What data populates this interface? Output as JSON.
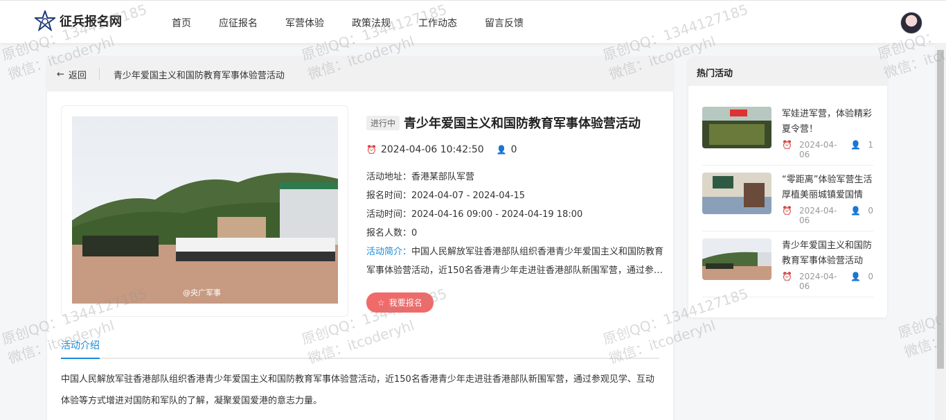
{
  "brand": {
    "name": "征兵报名网"
  },
  "nav": {
    "items": [
      "首页",
      "应征报名",
      "军营体验",
      "政策法规",
      "工作动态",
      "留言反馈"
    ]
  },
  "breadcrumb": {
    "back": "返回",
    "current": "青少年爱国主义和国防教育军事体验营活动"
  },
  "activity": {
    "status": "进行中",
    "title": "青少年爱国主义和国防教育军事体验营活动",
    "date": "2024-04-06 10:42:50",
    "views": "0",
    "address_label": "活动地址：",
    "address": "香港某部队军营",
    "signup_label": "报名时间：",
    "signup": "2024-04-07 - 2024-04-15",
    "time_label": "活动时间：",
    "time": "2024-04-16 09:00 - 2024-04-19 18:00",
    "count_label": "报名人数：",
    "count": "0",
    "intro_label": "活动简介：",
    "intro": "中国人民解放军驻香港部队组织香港青少年爱国主义和国防教育军事体验营活动，近150名香港青少年走进驻香港部队新围军营，通过参观见学、互动体验等方式增进对国防和军队的了解，凝聚爱国爱港的意志力量。",
    "apply_button": "我要报名",
    "photo_caption": "@央广军事"
  },
  "tabs": {
    "intro_tab": "活动介绍"
  },
  "description": "中国人民解放军驻香港部队组织香港青少年爱国主义和国防教育军事体验营活动，近150名香港青少年走进驻香港部队新围军营，通过参观见学、互动体验等方式增进对国防和军队的了解，凝聚爱国爱港的意志力量。",
  "sidebar": {
    "title": "热门活动",
    "items": [
      {
        "title": "军娃进军营，体验精彩夏令营！",
        "date": "2024-04-06",
        "count": "1"
      },
      {
        "title": "“零距离”体验军营生活 厚植美丽城镇爱国情",
        "date": "2024-04-06",
        "count": "0"
      },
      {
        "title": "青少年爱国主义和国防教育军事体验营活动",
        "date": "2024-04-06",
        "count": "0"
      }
    ]
  },
  "watermark": {
    "line1": "原创QQ：1344127185",
    "line2": "微信：itcoderyhl"
  },
  "colors": {
    "accent": "#1a8ad8",
    "apply": "#f06a6a"
  }
}
